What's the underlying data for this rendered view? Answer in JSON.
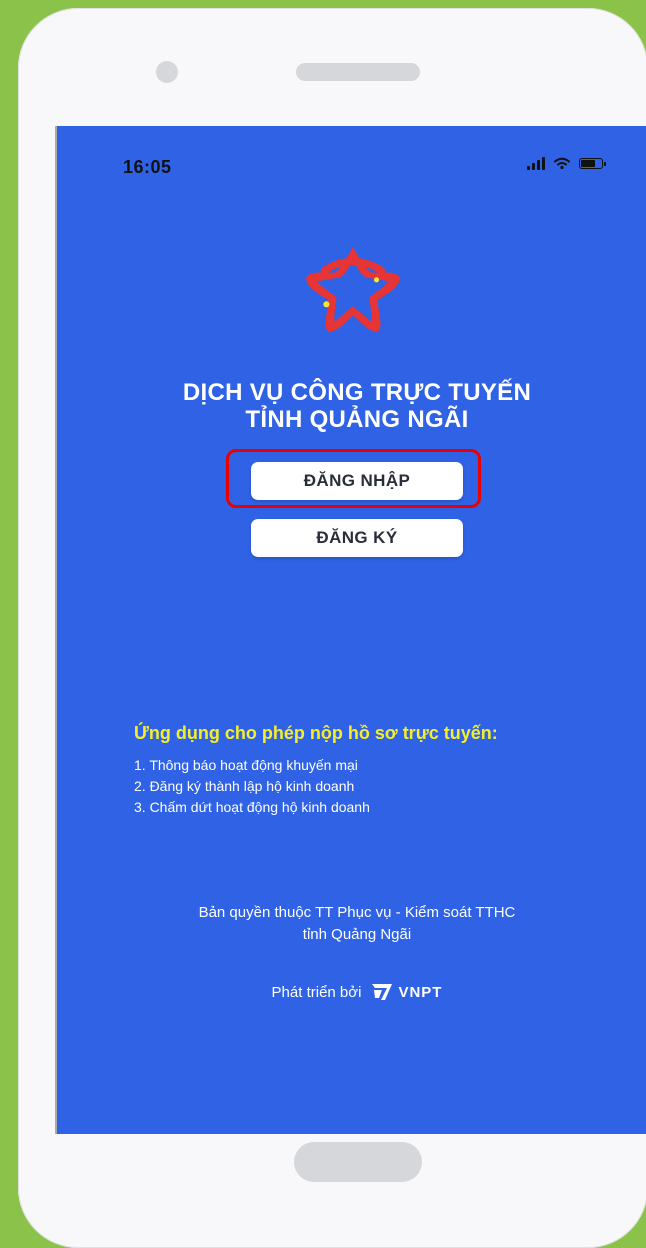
{
  "status_bar": {
    "time": "16:05"
  },
  "app": {
    "title_line_1": "DỊCH VỤ CÔNG TRỰC TUYẾN",
    "title_line_2": "TỈNH QUẢNG NGÃI"
  },
  "buttons": {
    "login": "ĐĂNG NHẬP",
    "register": "ĐĂNG KÝ"
  },
  "info": {
    "title": "Ứng dụng cho phép nộp hồ sơ trực tuyến:",
    "items": [
      "1. Thông báo hoạt động khuyến mại",
      "2. Đăng ký thành lập hộ kinh doanh",
      "3. Chấm dứt hoạt động hộ kinh doanh"
    ]
  },
  "footer": {
    "copyright_line_1": "Bản quyền thuộc TT Phục vụ - Kiểm soát TTHC",
    "copyright_line_2": "tỉnh Quảng Ngãi",
    "developed_by": "Phát triển bởi",
    "brand": "VNPT"
  },
  "colors": {
    "page_background": "#8bc34a",
    "screen_background": "#2f62e4",
    "highlight": "#ea0000",
    "info_title": "#f5ef2a"
  },
  "icons": {
    "status_signal": "signal-icon",
    "status_wifi": "wifi-icon",
    "status_battery": "battery-icon",
    "app_logo": "vnpt-star-logo",
    "brand_logo": "vnpt-logo-icon"
  }
}
